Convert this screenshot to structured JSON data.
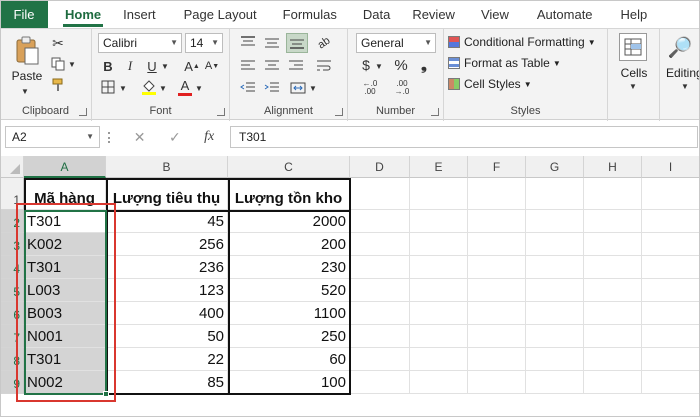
{
  "tabs": [
    "File",
    "Home",
    "Insert",
    "Page Layout",
    "Formulas",
    "Data",
    "Review",
    "View",
    "Automate",
    "Help"
  ],
  "active_tab": "Home",
  "ribbon": {
    "clipboard": {
      "paste_label": "Paste",
      "group_label": "Clipboard"
    },
    "font": {
      "family": "Calibri",
      "size": "14",
      "bold": "B",
      "italic": "I",
      "underline": "U",
      "group_label": "Font",
      "font_color_glyph": "A",
      "highlight_color": "#ffff00",
      "font_color": "#e02020"
    },
    "alignment": {
      "group_label": "Alignment"
    },
    "number": {
      "format": "General",
      "currency": "$",
      "percent": "%",
      "comma": "❟",
      "group_label": "Number"
    },
    "styles": {
      "conditional": "Conditional Formatting",
      "format_table": "Format as Table",
      "cell_styles": "Cell Styles",
      "group_label": "Styles"
    },
    "cells": {
      "label": "Cells"
    },
    "editing": {
      "label": "Editing"
    }
  },
  "formula_bar": {
    "name_box": "A2",
    "fx": "fx",
    "value": "T301"
  },
  "columns": [
    "A",
    "B",
    "C",
    "D",
    "E",
    "F",
    "G",
    "H",
    "I"
  ],
  "rows": [
    "1",
    "2",
    "3",
    "4",
    "5",
    "6",
    "7",
    "8",
    "9"
  ],
  "table": {
    "headers": [
      "Mã hàng",
      "Lượng tiêu thụ",
      "Lượng tồn kho"
    ],
    "rows": [
      [
        "T301",
        "45",
        "2000"
      ],
      [
        "K002",
        "256",
        "200"
      ],
      [
        "T301",
        "236",
        "230"
      ],
      [
        "L003",
        "123",
        "520"
      ],
      [
        "B003",
        "400",
        "1100"
      ],
      [
        "N001",
        "50",
        "250"
      ],
      [
        "T301",
        "22",
        "60"
      ],
      [
        "N002",
        "85",
        "100"
      ]
    ]
  },
  "colors": {
    "excel_green": "#217346",
    "highlight_box": "#d9372f",
    "selection_fill": "#d4d4d4"
  }
}
